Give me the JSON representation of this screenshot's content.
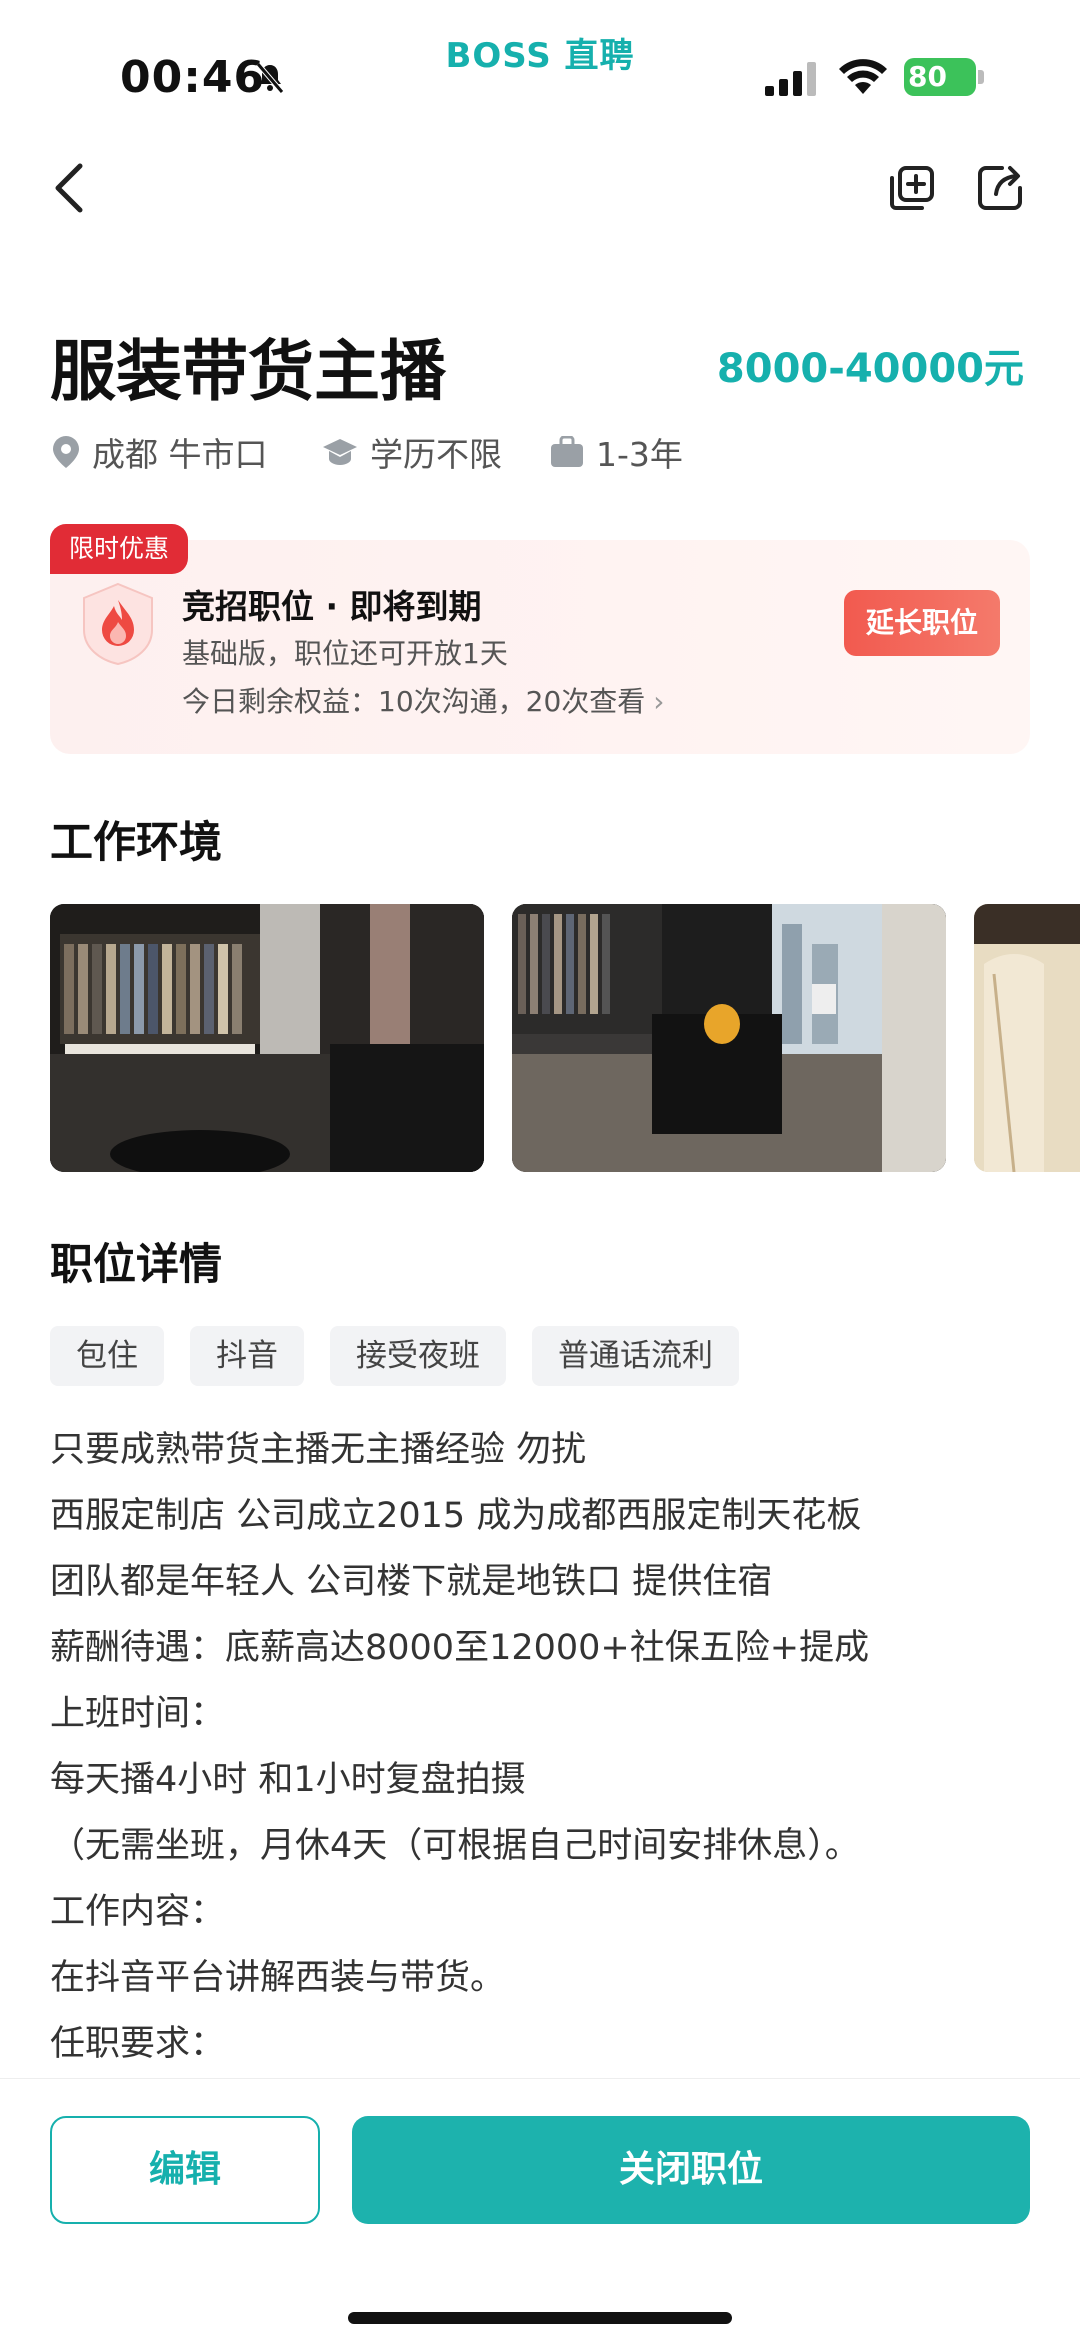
{
  "status_bar": {
    "time": "00:46",
    "brand": "BOSS 直聘",
    "battery": "80"
  },
  "job": {
    "title": "服装带货主播",
    "salary": "8000-40000元",
    "location": "成都 牛市口",
    "education": "学历不限",
    "experience": "1-3年"
  },
  "promo": {
    "badge": "限时优惠",
    "title": "竞招职位 · 即将到期",
    "subtitle": "基础版，职位还可开放1天",
    "rights": "今日剩余权益：10次沟通，20次查看",
    "extend_label": "延长职位"
  },
  "sections": {
    "environment": "工作环境",
    "details": "职位详情"
  },
  "tags": [
    "包住",
    "抖音",
    "接受夜班",
    "普通话流利"
  ],
  "description": [
    "只要成熟带货主播无主播经验 勿扰",
    "西服定制店 公司成立2015 成为成都西服定制天花板",
    "团队都是年轻人 公司楼下就是地铁口 提供住宿",
    "薪酬待遇：底薪高达8000至12000+社保五险+提成",
    "上班时间：",
    "每天播4小时 和1小时复盘拍摄",
    "（无需坐班，月休4天（可根据自己时间安排休息）。",
    "工作内容：",
    "在抖音平台讲解西装与带货。",
    "任职要求："
  ],
  "actions": {
    "edit_label": "编辑",
    "close_label": "关闭职位"
  },
  "colors": {
    "accent": "#16b0ad",
    "promo_red": "#e12c36",
    "extend_button": "#f25a4f"
  }
}
